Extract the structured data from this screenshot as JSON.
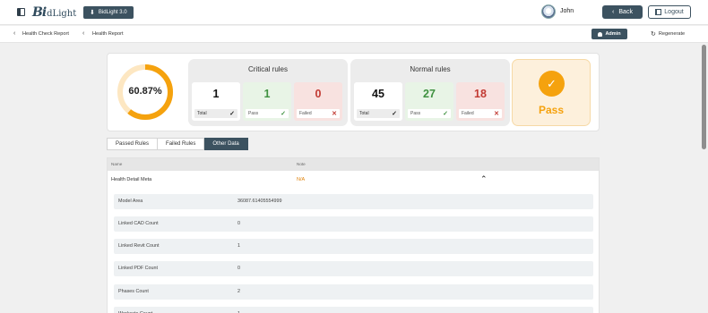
{
  "header": {
    "logo_mark": "Bi",
    "logo_word": "dLight",
    "version_label": "BidLight 3.0",
    "user_name": "John",
    "back_label": "Back",
    "logout_label": "Logout"
  },
  "breadcrumb": {
    "items": [
      "Health Check Report",
      "Health Report"
    ],
    "admin_label": "Admin",
    "regenerate_label": "Regenerate"
  },
  "summary": {
    "score_text": "60.87%",
    "score_fraction": 0.6087,
    "critical": {
      "title": "Critical rules",
      "total": "1",
      "pass": "1",
      "failed": "0"
    },
    "normal": {
      "title": "Normal rules",
      "total": "45",
      "pass": "27",
      "failed": "18"
    },
    "labels": {
      "total": "Total",
      "pass": "Pass",
      "failed": "Failed"
    },
    "result": "Pass"
  },
  "tabs": [
    "Passed Rules",
    "Failed Rules",
    "Other Data"
  ],
  "active_tab": "Other Data",
  "table": {
    "columns": [
      "Name",
      "Note"
    ],
    "main_row": {
      "name": "Health Detail Meta",
      "note": "N/A"
    },
    "details": [
      {
        "key": "Model Area",
        "value": "36087.61405554999"
      },
      {
        "key": "Linked CAD Count",
        "value": "0"
      },
      {
        "key": "Linked Revit Count",
        "value": "1"
      },
      {
        "key": "Linked PDF Count",
        "value": "0"
      },
      {
        "key": "Phases Count",
        "value": "2"
      },
      {
        "key": "Worksets Count",
        "value": "1"
      }
    ]
  },
  "colors": {
    "accent_dark": "#3c5260",
    "score_orange": "#f5a20e",
    "pass_green": "#3f9140",
    "fail_red": "#c23a33"
  }
}
